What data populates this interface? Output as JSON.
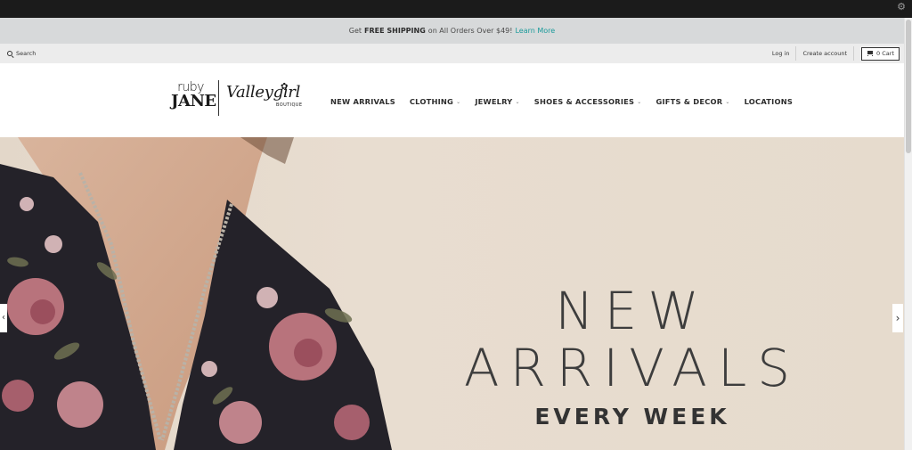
{
  "promo": {
    "prefix": "Get",
    "bold": "FREE SHIPPING",
    "suffix": "on All Orders Over $49!",
    "link": "Learn More"
  },
  "utility": {
    "search": "Search",
    "login": "Log in",
    "create_account": "Create account",
    "cart": "0 Cart"
  },
  "logo": {
    "ruby_top": "ruby",
    "ruby_bottom": "JANE",
    "valley": "Valleygirl",
    "valley_sub": "BOUTIQUE"
  },
  "nav": {
    "items": [
      {
        "label": "NEW ARRIVALS",
        "has_dropdown": false
      },
      {
        "label": "CLOTHING",
        "has_dropdown": true
      },
      {
        "label": "JEWELRY",
        "has_dropdown": true
      },
      {
        "label": "SHOES & ACCESSORIES",
        "has_dropdown": true
      },
      {
        "label": "GIFTS & DECOR",
        "has_dropdown": true
      },
      {
        "label": "LOCATIONS",
        "has_dropdown": false
      }
    ]
  },
  "hero": {
    "headline": "NEW ARRIVALS",
    "subheadline": "EVERY WEEK"
  },
  "icons": {
    "chevron": "⌄",
    "prev": "‹",
    "next": "›",
    "gear": "⚙"
  },
  "colors": {
    "promo_link": "#1a9a9a",
    "topbar": "#1b1b1b",
    "promo_bg": "#d7d9da",
    "hero_bg": "#e6dbcd"
  }
}
